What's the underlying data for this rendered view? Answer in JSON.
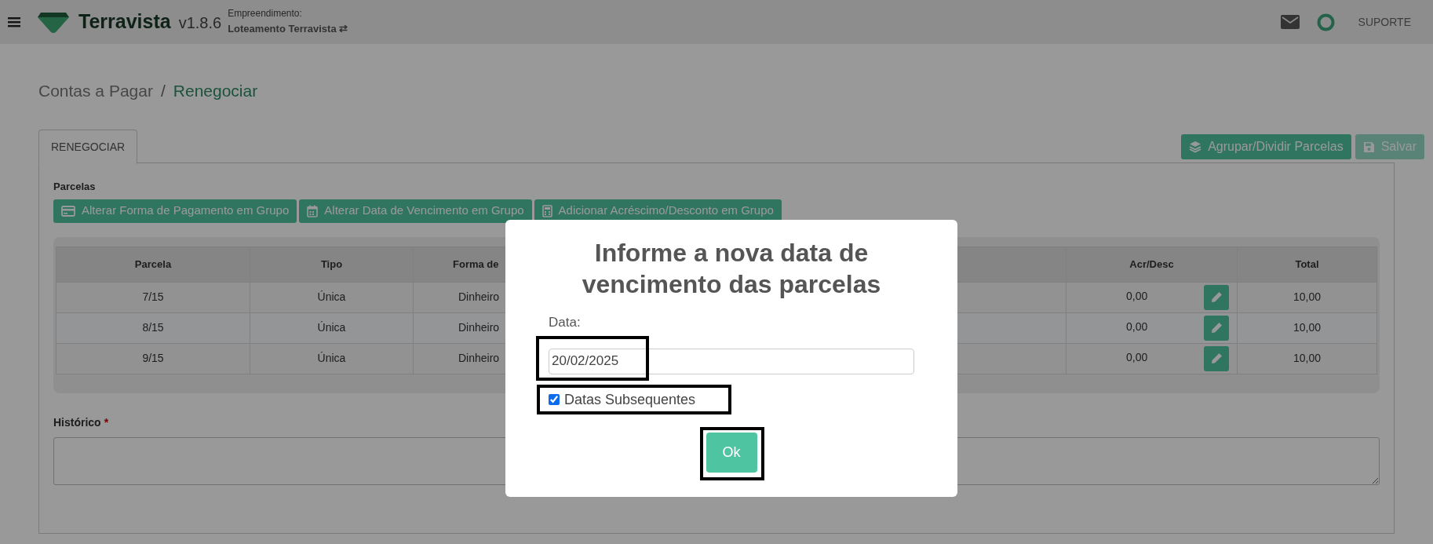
{
  "header": {
    "brand": "Terravista",
    "version": "v1.8.6",
    "project_label": "Empreendimento:",
    "project_name": "Loteamento Terravista",
    "swap_glyph": "⇄",
    "support": "SUPORTE"
  },
  "breadcrumb": {
    "separator": "/",
    "items": [
      {
        "label": "Contas a Pagar",
        "current": false
      },
      {
        "label": "Renegociar",
        "current": true
      }
    ]
  },
  "tabs": [
    {
      "label": "RENEGOCIAR",
      "selected": true
    }
  ],
  "actions": [
    {
      "label": "Agrupar/Dividir Parcelas",
      "disabled": false
    },
    {
      "label": "Salvar",
      "disabled": true
    }
  ],
  "section_title": "Parcelas",
  "group_buttons": [
    {
      "label": "Alterar Forma de Pagamento em Grupo"
    },
    {
      "label": "Alterar Data de Vencimento em Grupo"
    },
    {
      "label": "Adicionar Acréscimo/Desconto em Grupo"
    }
  ],
  "table": {
    "columns": [
      "Parcela",
      "Tipo",
      "Forma de",
      "Acr/Desc",
      "Total"
    ],
    "rows": [
      {
        "cells": [
          "7/15",
          "Única",
          "Dinheiro",
          "0,00",
          "10,00"
        ]
      },
      {
        "cells": [
          "8/15",
          "Única",
          "Dinheiro",
          "0,00",
          "10,00"
        ]
      },
      {
        "cells": [
          "9/15",
          "Única",
          "Dinheiro",
          "0,00",
          "10,00"
        ]
      }
    ]
  },
  "historico": {
    "label": "Histórico",
    "required_mark": "*"
  },
  "modal": {
    "title": "Informe a nova data de vencimento das parcelas",
    "field_label": "Data:",
    "value": "20/02/2025",
    "checkbox": {
      "label": "Datas Subsequentes",
      "checked": true
    },
    "button": "Ok"
  }
}
